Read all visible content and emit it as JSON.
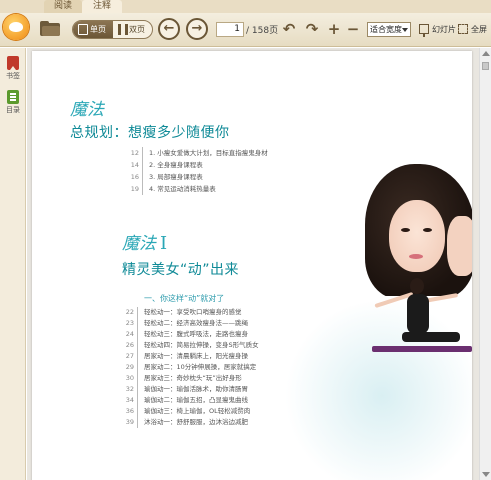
{
  "tabs": [
    {
      "label": "阅读"
    },
    {
      "label": "注释"
    }
  ],
  "toolbar": {
    "view_single": "单页",
    "view_double": "双页",
    "page_current": "1",
    "page_total": "/ 158页",
    "zoom_value": "适合宽度",
    "slideshow_label": "幻灯片",
    "fullscreen_label": "全屏"
  },
  "sidebar": {
    "items": [
      {
        "label": "书签",
        "icon": "bookmark-icon"
      },
      {
        "label": "目录",
        "icon": "toc-icon"
      }
    ]
  },
  "page": {
    "section1_tag": "魔法",
    "section1_title": "总规划：想瘦多少随便你",
    "section1_toc": [
      {
        "page": "12",
        "text": "1. 小瘦女爱做大计划，目标直指瘦鬼身材"
      },
      {
        "page": "14",
        "text": "2. 全身瘦身课程表"
      },
      {
        "page": "16",
        "text": "3. 局部瘦身课程表"
      },
      {
        "page": "19",
        "text": "4. 常见运动消耗热量表"
      }
    ],
    "section2_tag": "魔法",
    "section2_num": "I",
    "section2_title": "精灵美女“动”出来",
    "subsection_title": "一、你这样“动”就对了",
    "section2_toc": [
      {
        "page": "22",
        "text": "轻松动一：享受吹口哨瘦身的感觉"
      },
      {
        "page": "23",
        "text": "轻松动二：经济高效瘦身法——跳绳"
      },
      {
        "page": "24",
        "text": "轻松动三：腹式呼吸法，走路也瘦身"
      },
      {
        "page": "26",
        "text": "轻松动四：简易拉伸操，变身S形气质女"
      },
      {
        "page": "27",
        "text": "居家动一：清晨躺床上，阳光瘦身操"
      },
      {
        "page": "29",
        "text": "居家动二：10分钟伸展操，居家就搞定"
      },
      {
        "page": "30",
        "text": "居家动三：奇妙枕头“玩”出好身形"
      },
      {
        "page": "32",
        "text": "瑜伽动一：瑜伽活脉术，助你清肠胃"
      },
      {
        "page": "34",
        "text": "瑜伽动二：瑜伽五招，凸显瘦鬼曲线"
      },
      {
        "page": "36",
        "text": "瑜伽动三：椅上瑜伽，OL轻松减赘肉"
      },
      {
        "page": "39",
        "text": "沐浴动一：舒舒服服，边沐浴边减肥"
      }
    ]
  },
  "colors": {
    "accent_teal": "#0f8a97",
    "toolbar_bg": "#e6dcc2",
    "toolbar_brown": "#6a5636"
  }
}
